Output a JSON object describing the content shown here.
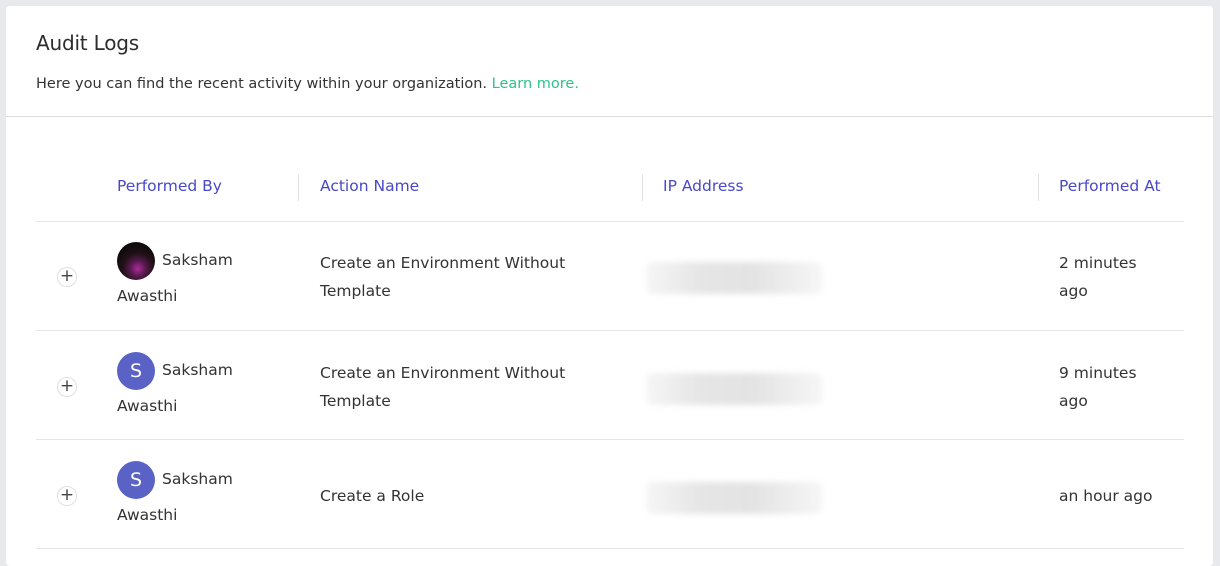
{
  "header": {
    "title": "Audit Logs",
    "subtitle": "Here you can find the recent activity within your organization.",
    "learn_more": "Learn more."
  },
  "table": {
    "columns": [
      "Performed By",
      "Action Name",
      "IP Address",
      "Performed At"
    ],
    "rows": [
      {
        "expand": "+",
        "avatar_type": "photo",
        "avatar_letter": "",
        "first_name": "Saksham",
        "last_name": "Awasthi",
        "action": "Create an Environment Without Template",
        "ip": "",
        "time": "2 minutes ago"
      },
      {
        "expand": "+",
        "avatar_type": "letter",
        "avatar_letter": "S",
        "first_name": "Saksham",
        "last_name": "Awasthi",
        "action": "Create an Environment Without Template",
        "ip": "",
        "time": "9 minutes ago"
      },
      {
        "expand": "+",
        "avatar_type": "letter",
        "avatar_letter": "S",
        "first_name": "Saksham",
        "last_name": "Awasthi",
        "action": "Create a Role",
        "ip": "",
        "time": "an hour ago"
      }
    ]
  },
  "colors": {
    "accent_header": "#4848c8",
    "link": "#2cc38a",
    "avatar_bg": "#5a62c6"
  },
  "icons": {
    "expand": "plus-icon"
  }
}
